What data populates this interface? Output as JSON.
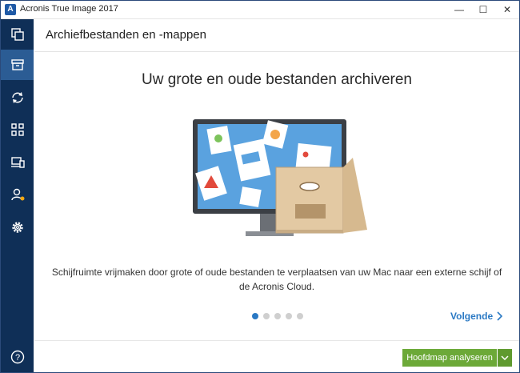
{
  "window": {
    "title": "Acronis True Image 2017"
  },
  "header": {
    "title": "Archiefbestanden en -mappen"
  },
  "main": {
    "heading": "Uw grote en oude bestanden archiveren",
    "description": "Schijfruimte vrijmaken door grote of oude bestanden te verplaatsen van uw Mac naar een externe schijf of de Acronis Cloud.",
    "pager": {
      "count": 5,
      "active_index": 0
    },
    "next_label": "Volgende"
  },
  "footer": {
    "primary_button_label": "Hoofdmap analyseren"
  },
  "sidebar": {
    "items": [
      {
        "icon": "backup-icon"
      },
      {
        "icon": "archive-icon",
        "active": true
      },
      {
        "icon": "sync-icon"
      },
      {
        "icon": "dashboard-icon"
      },
      {
        "icon": "devices-icon"
      },
      {
        "icon": "account-icon"
      },
      {
        "icon": "settings-icon"
      },
      {
        "icon": "help-icon"
      }
    ]
  },
  "colors": {
    "sidebar_bg": "#0f2f57",
    "active_item": "#2b5c94",
    "primary": "#6ca938",
    "link": "#2a79c4"
  }
}
